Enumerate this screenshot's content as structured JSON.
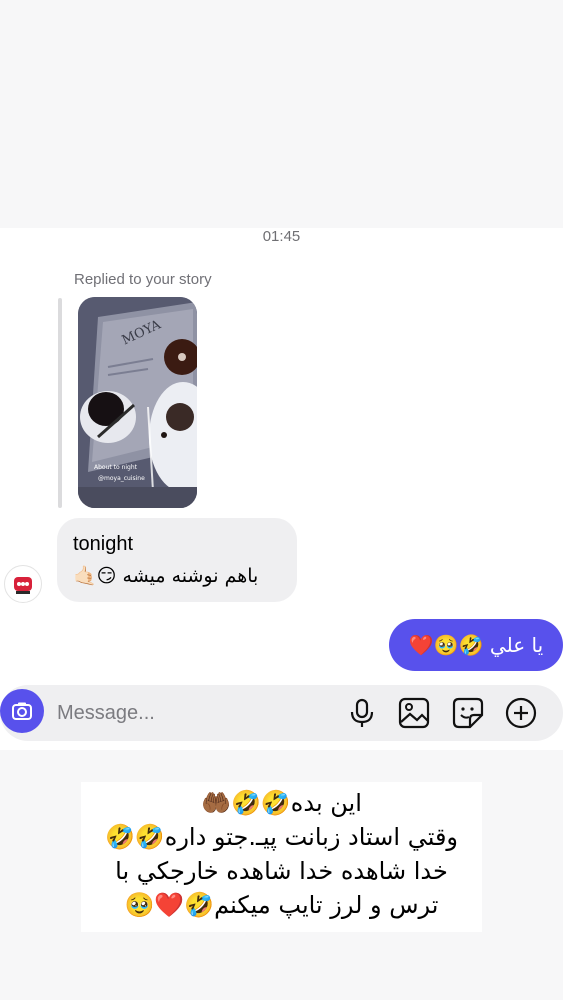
{
  "conversation": {
    "timestamp": "01:45",
    "reply_label": "Replied to your story",
    "story": {
      "logo_text": "MOYA",
      "caption_line1": "About to night",
      "caption_line2": "@moya_cuisine"
    },
    "incoming_message": {
      "line1": "tonight",
      "line2": "باهم نوشنه میشه 😏🤙🏻"
    },
    "outgoing_message": "يا علي 🤣🥹❤️"
  },
  "composer": {
    "placeholder": "Message...",
    "icons": [
      "camera-icon",
      "microphone-icon",
      "gallery-icon",
      "sticker-icon",
      "add-icon"
    ]
  },
  "caption": {
    "lines": [
      "این بده🤣🤣🤲🏾",
      "وقتي استاد زبانت پيـ.جتو داره🤣🤣",
      "خدا شاهده خدا شاهده خارجکي با",
      "ترس و لرز تايپ ميکنم🤣❤️🥹"
    ]
  },
  "colors": {
    "accent": "#5851EC",
    "bubble_gray": "#EFEFF1",
    "page_bg": "#F7F7F8"
  }
}
